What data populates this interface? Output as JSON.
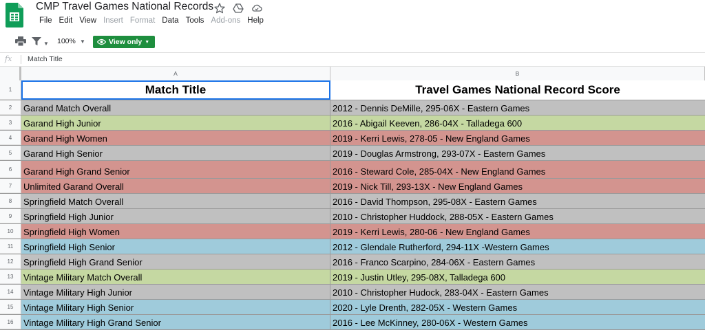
{
  "title": "CMP Travel Games National Records",
  "menu": [
    "File",
    "Edit",
    "View",
    "Insert",
    "Format",
    "Data",
    "Tools",
    "Add-ons",
    "Help"
  ],
  "menu_disabled": [
    "Insert",
    "Format",
    "Add-ons"
  ],
  "toolbar": {
    "zoom": "100%",
    "view_only_label": "View only"
  },
  "formula_bar": {
    "fx": "fx",
    "content": "Match Title"
  },
  "columns": [
    "A",
    "B"
  ],
  "colors": {
    "gray": "#c0c0c0",
    "green": "#c5d8a2",
    "red": "#d3948f",
    "blue": "#9fcbdb",
    "view_only_green": "#1e8e3e",
    "selection_blue": "#1a73e8"
  },
  "rows": [
    {
      "num": "1",
      "a": "Match Title",
      "b": "Travel Games National Record Score",
      "color": "white",
      "header": true
    },
    {
      "num": "2",
      "a": "Garand Match Overall",
      "b": "2012 - Dennis DeMille, 295-06X - Eastern Games",
      "color": "gray"
    },
    {
      "num": "3",
      "a": "Garand High Junior",
      "b": "2016 - Abigail Keeven, 286-04X - Talladega 600",
      "color": "green"
    },
    {
      "num": "4",
      "a": "Garand High Women",
      "b": "2019 - Kerri Lewis, 278-05 - New England Games",
      "color": "red"
    },
    {
      "num": "5",
      "a": "Garand High Senior",
      "b": "2019 - Douglas Armstrong, 293-07X - Eastern Games",
      "color": "gray"
    },
    {
      "num": "6",
      "a": "Garand High Grand Senior",
      "b": "2016 - Steward Cole, 285-04X - New England Games",
      "color": "red"
    },
    {
      "num": "7",
      "a": "Unlimited Garand Overall",
      "b": "2019 - Nick Till, 293-13X - New England Games",
      "color": "red"
    },
    {
      "num": "8",
      "a": "Springfield Match Overall",
      "b": "2016 - David Thompson, 295-08X - Eastern Games",
      "color": "gray"
    },
    {
      "num": "9",
      "a": "Springfield High Junior",
      "b": "2010 - Christopher Huddock, 288-05X - Eastern Games",
      "color": "gray"
    },
    {
      "num": "10",
      "a": "Springfield High Women",
      "b": "2019 - Kerri Lewis, 280-06 - New England Games",
      "color": "red"
    },
    {
      "num": "11",
      "a": "Springfield High Senior",
      "b": "2012 - Glendale Rutherford, 294-11X -Western Games",
      "color": "blue"
    },
    {
      "num": "12",
      "a": "Springfield High Grand Senior",
      "b": "2016 - Franco Scarpino, 284-06X - Eastern Games",
      "color": "gray"
    },
    {
      "num": "13",
      "a": "Vintage Military Match Overall",
      "b": "2019 - Justin Utley, 295-08X, Talladega 600",
      "color": "green"
    },
    {
      "num": "14",
      "a": "Vintage Military High Junior",
      "b": "2010 - Christopher Hudock, 283-04X - Eastern Games",
      "color": "gray"
    },
    {
      "num": "15",
      "a": "Vintage Military High Senior",
      "b": "2020 - Lyle Drenth, 282-05X - Western Games",
      "color": "blue"
    },
    {
      "num": "16",
      "a": "Vintage Military High Grand Senior",
      "b": "2016 - Lee McKinney, 280-06X - Western Games",
      "color": "blue"
    }
  ]
}
